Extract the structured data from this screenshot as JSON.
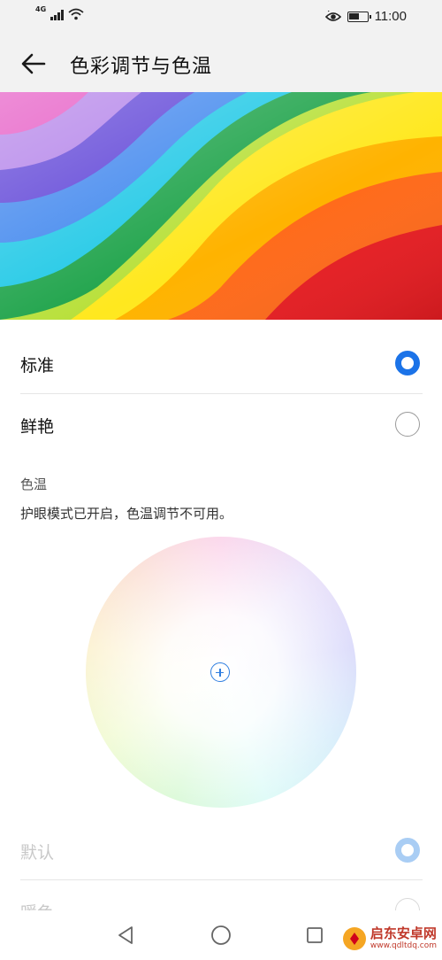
{
  "status_bar": {
    "network": "4G",
    "time": "11:00",
    "icons": [
      "signal-icon",
      "wifi-icon",
      "eye-comfort-icon",
      "battery-icon"
    ],
    "battery_percent": 60
  },
  "header": {
    "title": "色彩调节与色温",
    "back_icon": "arrow-left-icon"
  },
  "color_modes": [
    {
      "label": "标准",
      "selected": true
    },
    {
      "label": "鲜艳",
      "selected": false
    }
  ],
  "color_temperature": {
    "section_title": "色温",
    "notice": "护眼模式已开启，色温调节不可用。",
    "options": [
      {
        "label": "默认",
        "selected": true,
        "enabled": false
      },
      {
        "label": "暖色",
        "selected": false,
        "enabled": false
      }
    ]
  },
  "nav_bar": {
    "buttons": [
      "back-triangle-icon",
      "home-circle-icon",
      "recents-square-icon"
    ]
  },
  "watermark": {
    "name": "启东安卓网",
    "url": "www.qdltdq.com"
  },
  "colors": {
    "accent": "#1b73e8",
    "accent_disabled": "#a9cdf4",
    "bar_bg": "#f2f2f2"
  }
}
